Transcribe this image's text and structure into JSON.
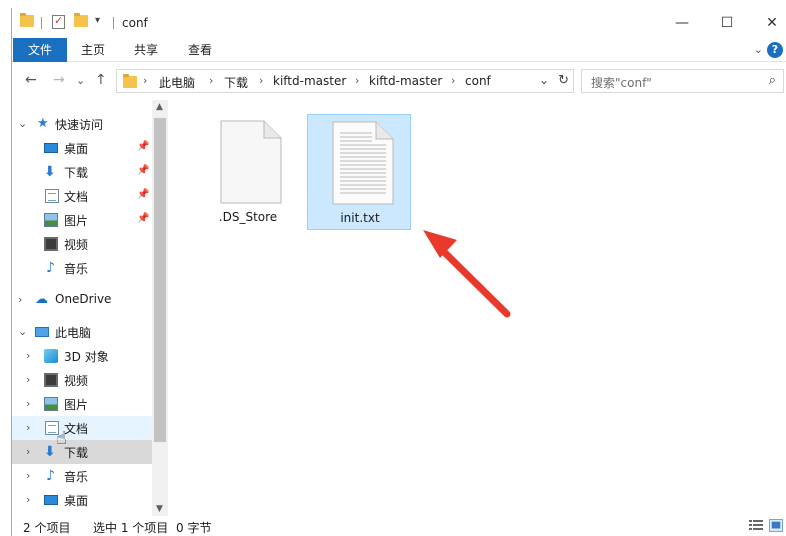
{
  "window": {
    "title": "conf",
    "quick_access": [
      "folder-icon",
      "properties-check-icon",
      "new-folder-icon",
      "customize-dropdown-icon"
    ],
    "controls": {
      "minimize": "—",
      "maximize": "☐",
      "close": "✕"
    }
  },
  "ribbon": {
    "tabs": [
      {
        "label": "文件",
        "active": true
      },
      {
        "label": "主页"
      },
      {
        "label": "共享"
      },
      {
        "label": "查看"
      }
    ],
    "expand_icon": "⌄",
    "help_icon": "?"
  },
  "address": {
    "back": "←",
    "forward": "→",
    "recent": "⌄",
    "up": "↑",
    "crumbs": [
      "此电脑",
      "下载",
      "kiftd-master",
      "kiftd-master",
      "conf"
    ],
    "separator": "›",
    "dropdown": "⌄",
    "refresh": "↻"
  },
  "search": {
    "placeholder": "搜索\"conf\"",
    "icon": "⌕"
  },
  "nav": {
    "items": [
      {
        "label": "快速访问",
        "icon": "star-icon",
        "chev": "⌄",
        "level": 0
      },
      {
        "label": "桌面",
        "icon": "desktop-icon",
        "pinned": true,
        "level": 1
      },
      {
        "label": "下载",
        "icon": "download-icon",
        "pinned": true,
        "level": 1
      },
      {
        "label": "文档",
        "icon": "document-icon",
        "pinned": true,
        "level": 1
      },
      {
        "label": "图片",
        "icon": "picture-icon",
        "pinned": true,
        "level": 1
      },
      {
        "label": "视频",
        "icon": "video-icon",
        "level": 1
      },
      {
        "label": "音乐",
        "icon": "music-icon",
        "level": 1
      },
      {
        "label": "OneDrive",
        "icon": "cloud-icon",
        "chev": "›",
        "level": 0
      },
      {
        "label": "此电脑",
        "icon": "computer-icon",
        "chev": "⌄",
        "level": 0
      },
      {
        "label": "3D 对象",
        "icon": "3d-objects-icon",
        "chev": "›",
        "level": 1
      },
      {
        "label": "视频",
        "icon": "video-icon",
        "chev": "›",
        "level": 1
      },
      {
        "label": "图片",
        "icon": "picture-icon",
        "chev": "›",
        "level": 1
      },
      {
        "label": "文档",
        "icon": "document-icon",
        "chev": "›",
        "level": 1,
        "state": "hover"
      },
      {
        "label": "下载",
        "icon": "download-icon",
        "chev": "›",
        "level": 1,
        "state": "pressed"
      },
      {
        "label": "音乐",
        "icon": "music-icon",
        "chev": "›",
        "level": 1
      },
      {
        "label": "桌面",
        "icon": "desktop-icon",
        "chev": "›",
        "level": 1
      }
    ],
    "pin_glyph": "📌"
  },
  "files": [
    {
      "name": ".DS_Store",
      "icon": "blank-file-icon",
      "selected": false
    },
    {
      "name": "init.txt",
      "icon": "text-file-icon",
      "selected": true
    }
  ],
  "status": {
    "count": "2 个项目",
    "selection": "选中 1 个项目",
    "size": "0 字节"
  },
  "colors": {
    "accent": "#1a6fc0",
    "selection_bg": "#cce8ff",
    "selection_border": "#99d1ff",
    "annotation_arrow": "#e8392b"
  }
}
